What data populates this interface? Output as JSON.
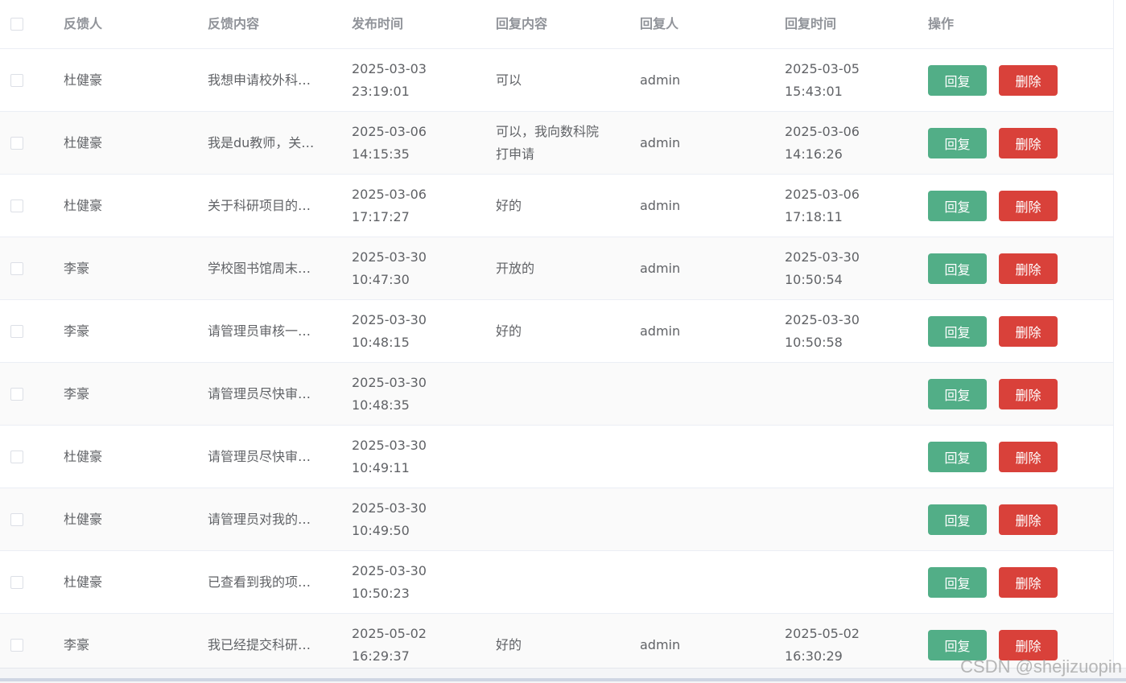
{
  "header": {
    "name": "反馈人",
    "content": "反馈内容",
    "publish_time": "发布时间",
    "reply_content": "回复内容",
    "replier": "回复人",
    "reply_time": "回复时间",
    "actions": "操作"
  },
  "buttons": {
    "reply": "回复",
    "delete": "删除"
  },
  "rows": [
    {
      "name": "杜健豪",
      "content": "我想申请校外科…",
      "pub_date": "2025-03-03",
      "pub_time": "23:19:01",
      "reply1": "可以",
      "reply2": "",
      "replier": "admin",
      "rdate": "2025-03-05",
      "rtime": "15:43:01"
    },
    {
      "name": "杜健豪",
      "content": "我是du教师，关…",
      "pub_date": "2025-03-06",
      "pub_time": "14:15:35",
      "reply1": "可以，我向数科院",
      "reply2": "打申请",
      "replier": "admin",
      "rdate": "2025-03-06",
      "rtime": "14:16:26"
    },
    {
      "name": "杜健豪",
      "content": "关于科研项目的…",
      "pub_date": "2025-03-06",
      "pub_time": "17:17:27",
      "reply1": "好的",
      "reply2": "",
      "replier": "admin",
      "rdate": "2025-03-06",
      "rtime": "17:18:11"
    },
    {
      "name": "李豪",
      "content": "学校图书馆周末…",
      "pub_date": "2025-03-30",
      "pub_time": "10:47:30",
      "reply1": "开放的",
      "reply2": "",
      "replier": "admin",
      "rdate": "2025-03-30",
      "rtime": "10:50:54"
    },
    {
      "name": "李豪",
      "content": "请管理员审核一…",
      "pub_date": "2025-03-30",
      "pub_time": "10:48:15",
      "reply1": "好的",
      "reply2": "",
      "replier": "admin",
      "rdate": "2025-03-30",
      "rtime": "10:50:58"
    },
    {
      "name": "李豪",
      "content": "请管理员尽快审…",
      "pub_date": "2025-03-30",
      "pub_time": "10:48:35",
      "reply1": "",
      "reply2": "",
      "replier": "",
      "rdate": "",
      "rtime": ""
    },
    {
      "name": "杜健豪",
      "content": "请管理员尽快审…",
      "pub_date": "2025-03-30",
      "pub_time": "10:49:11",
      "reply1": "",
      "reply2": "",
      "replier": "",
      "rdate": "",
      "rtime": ""
    },
    {
      "name": "杜健豪",
      "content": "请管理员对我的…",
      "pub_date": "2025-03-30",
      "pub_time": "10:49:50",
      "reply1": "",
      "reply2": "",
      "replier": "",
      "rdate": "",
      "rtime": ""
    },
    {
      "name": "杜健豪",
      "content": "已查看到我的项…",
      "pub_date": "2025-03-30",
      "pub_time": "10:50:23",
      "reply1": "",
      "reply2": "",
      "replier": "",
      "rdate": "",
      "rtime": ""
    },
    {
      "name": "李豪",
      "content": "我已经提交科研…",
      "pub_date": "2025-05-02",
      "pub_time": "16:29:37",
      "reply1": "好的",
      "reply2": "",
      "replier": "admin",
      "rdate": "2025-05-02",
      "rtime": "16:30:29"
    }
  ],
  "watermark": "CSDN @shejizuopin",
  "colors": {
    "reply_button": "#52ae87",
    "delete_button": "#d9413a",
    "stripe": "#fafafa"
  }
}
